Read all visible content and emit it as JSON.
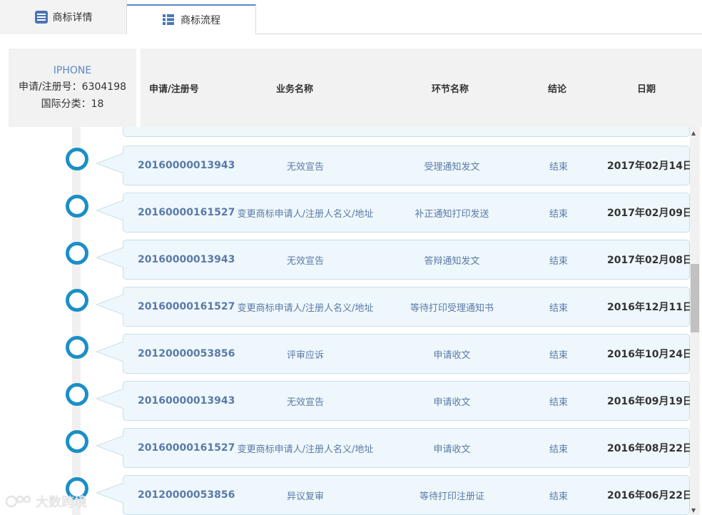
{
  "tabs": [
    {
      "label": "商标详情",
      "icon": "list-doc-icon"
    },
    {
      "label": "商标流程",
      "icon": "grid-list-icon"
    }
  ],
  "trademark": {
    "name": "IPHONE",
    "reg_line": "申请/注册号：6304198",
    "class_line": "国际分类：18"
  },
  "columns": [
    "申请/注册号",
    "业务名称",
    "环节名称",
    "结论",
    "日期"
  ],
  "rows": [
    {
      "no": "20160000013943",
      "business": "无效宣告",
      "step": "受理通知发文",
      "result": "结束",
      "date": "2017年02月14日"
    },
    {
      "no": "20160000161527",
      "business": "变更商标申请人/注册人名义/地址",
      "step": "补正通知打印发送",
      "result": "结束",
      "date": "2017年02月09日"
    },
    {
      "no": "20160000013943",
      "business": "无效宣告",
      "step": "答辩通知发文",
      "result": "结束",
      "date": "2017年02月08日"
    },
    {
      "no": "20160000161527",
      "business": "变更商标申请人/注册人名义/地址",
      "step": "等待打印受理通知书",
      "result": "结束",
      "date": "2016年12月11日"
    },
    {
      "no": "20120000053856",
      "business": "评审应诉",
      "step": "申请收文",
      "result": "结束",
      "date": "2016年10月24日"
    },
    {
      "no": "20160000013943",
      "business": "无效宣告",
      "step": "申请收文",
      "result": "结束",
      "date": "2016年09月19日"
    },
    {
      "no": "20160000161527",
      "business": "变更商标申请人/注册人名义/地址",
      "step": "申请收文",
      "result": "结束",
      "date": "2016年08月22日"
    },
    {
      "no": "20120000053856",
      "business": "异议复审",
      "step": "等待打印注册证",
      "result": "结束",
      "date": "2016年06月22日"
    }
  ],
  "watermark": "大数跨境",
  "colors": {
    "accent": "#5b87c5",
    "timeline_node": "#1b8fc6",
    "row_bg": "#eef7fb",
    "row_text": "#5b7aa8"
  }
}
